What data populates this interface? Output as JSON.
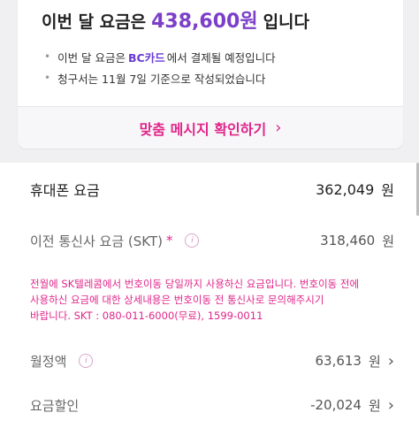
{
  "summary": {
    "headline_prefix": "이번 달 요금은",
    "headline_amount": "438,600원",
    "headline_suffix": "입니다",
    "bullets": {
      "payment_prefix": "이번 달 요금은",
      "payment_brand": "BC카드",
      "payment_suffix": "에서 결제될 예정입니다",
      "basis": "청구서는 11월 7일 기준으로 작성되었습니다"
    },
    "cta_label": "맞춤 메시지 확인하기"
  },
  "details": {
    "phone_fee": {
      "label": "휴대폰 요금",
      "value": "362,049",
      "unit": "원"
    },
    "prev_carrier": {
      "label": "이전 통신사 요금 (SKT)",
      "star": "*",
      "value": "318,460",
      "unit": "원"
    },
    "note_lines": [
      "전월에 SK텔레콤에서 번호이동 당일까지 사용하신 요금입니다. 번호이동 전에",
      "사용하신 요금에 대한 상세내용은 번호이동 전 통신사로 문의해주시기",
      "바랍니다. SKT : 080-011-6000(무료), 1599-0011"
    ],
    "monthly": {
      "label": "월정액",
      "value": "63,613",
      "unit": "원"
    },
    "discount": {
      "label": "요금할인",
      "value": "-20,024",
      "unit": "원"
    }
  },
  "icons": {
    "info": "info-icon",
    "chevron": "chevron-right-icon"
  },
  "colors": {
    "accent_purple": "#7b3fc8",
    "accent_pink": "#e0268a"
  }
}
